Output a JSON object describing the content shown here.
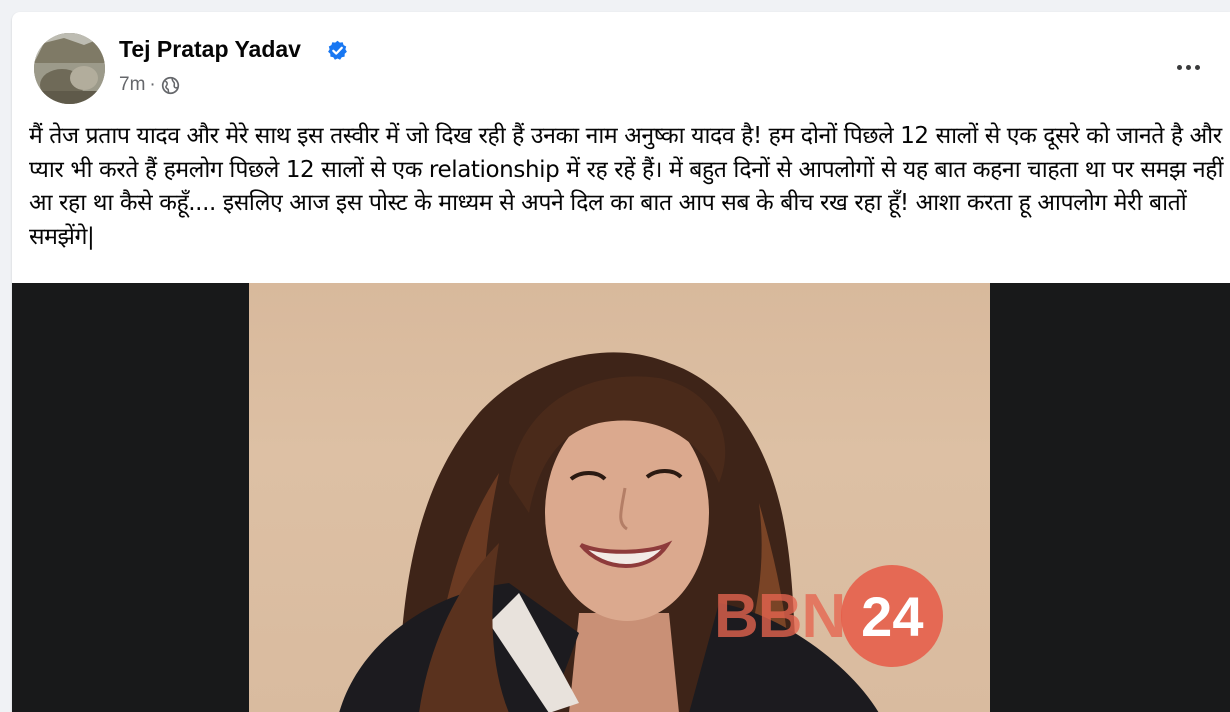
{
  "post": {
    "author": "Tej Pratap Yadav",
    "verified_icon": "verified-badge-icon",
    "timestamp": "7m",
    "separator": "·",
    "privacy_icon": "globe-icon",
    "more_icon": "more-options-icon",
    "text": "मैं तेज प्रताप यादव और  मेरे साथ इस तस्वीर में जो दिख रही हैं उनका नाम अनुष्का यादव है! हम दोनों पिछले 12 सालों से एक दूसरे को जानते है और प्यार भी करते हैं हमलोग पिछले 12 सालों से एक relationship में रह रहें हैं। में बहुत दिनों से आपलोगों से यह बात कहना चाहता था पर समझ नहीं आ रहा था कैसे कहूँ.... इसलिए आज इस पोस्ट के माध्यम से अपने दिल का बात आप सब के बीच रख रहा हूँ! आशा करता हू आपलोग मेरी बातों समझेंगे|"
  },
  "watermark": {
    "text": "BBN",
    "badge": "24"
  },
  "colors": {
    "verified": "#1877f2",
    "watermark": "#e65a46",
    "photo_background": "#d8b99c"
  }
}
